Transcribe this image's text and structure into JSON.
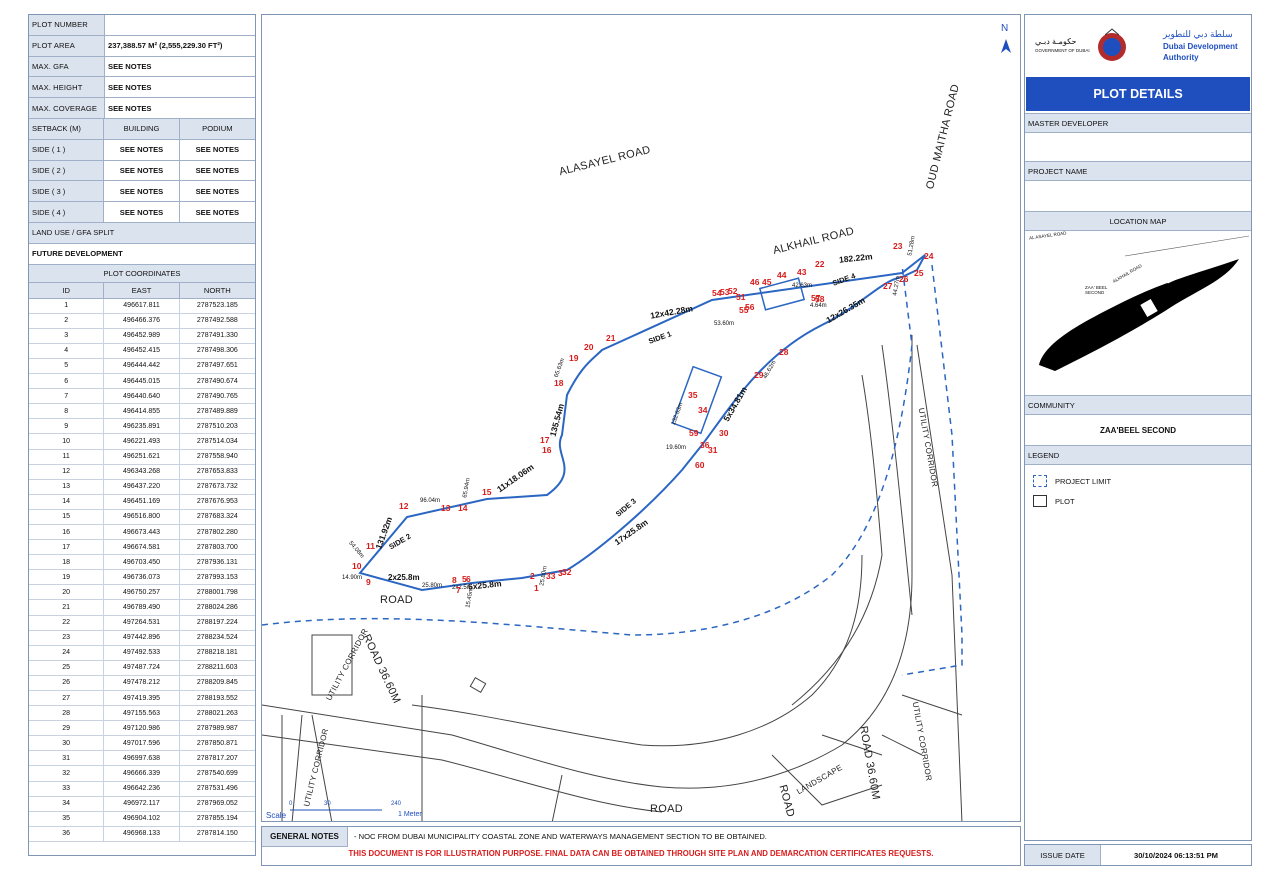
{
  "left": {
    "plot_number_label": "PLOT NUMBER",
    "plot_number_value": "",
    "plot_area_label": "PLOT AREA",
    "plot_area_value": "237,388.57 M² (2,555,229.30 FT²)",
    "max_gfa_label": "MAX. GFA",
    "max_gfa_value": "SEE NOTES",
    "max_height_label": "MAX. HEIGHT",
    "max_height_value": "SEE NOTES",
    "max_coverage_label": "MAX. COVERAGE",
    "max_coverage_value": "SEE NOTES",
    "setback_label": "SETBACK (M)",
    "building_label": "BUILDING",
    "podium_label": "PODIUM",
    "sides": [
      {
        "label": "SIDE ( 1 )",
        "building": "SEE NOTES",
        "podium": "SEE NOTES"
      },
      {
        "label": "SIDE ( 2 )",
        "building": "SEE NOTES",
        "podium": "SEE NOTES"
      },
      {
        "label": "SIDE ( 3 )",
        "building": "SEE NOTES",
        "podium": "SEE NOTES"
      },
      {
        "label": "SIDE ( 4 )",
        "building": "SEE NOTES",
        "podium": "SEE NOTES"
      }
    ],
    "land_use_label": "LAND USE / GFA SPLIT",
    "land_use_value": "FUTURE DEVELOPMENT",
    "coords_title": "PLOT COORDINATES",
    "coords_headers": [
      "ID",
      "EAST",
      "NORTH"
    ],
    "coords": [
      [
        "1",
        "496617.811",
        "2787523.185"
      ],
      [
        "2",
        "496466.376",
        "2787492.588"
      ],
      [
        "3",
        "496452.989",
        "2787491.330"
      ],
      [
        "4",
        "496452.415",
        "2787498.306"
      ],
      [
        "5",
        "496444.442",
        "2787497.651"
      ],
      [
        "6",
        "496445.015",
        "2787490.674"
      ],
      [
        "7",
        "496440.640",
        "2787490.765"
      ],
      [
        "8",
        "496414.855",
        "2787489.889"
      ],
      [
        "9",
        "496235.891",
        "2787510.203"
      ],
      [
        "10",
        "496221.493",
        "2787514.034"
      ],
      [
        "11",
        "496251.621",
        "2787558.940"
      ],
      [
        "12",
        "496343.268",
        "2787653.833"
      ],
      [
        "13",
        "496437.220",
        "2787673.732"
      ],
      [
        "14",
        "496451.169",
        "2787676.953"
      ],
      [
        "15",
        "496516.800",
        "2787683.324"
      ],
      [
        "16",
        "496673.443",
        "2787802.280"
      ],
      [
        "17",
        "496674.581",
        "2787803.700"
      ],
      [
        "18",
        "496703.450",
        "2787936.131"
      ],
      [
        "19",
        "496736.073",
        "2787993.153"
      ],
      [
        "20",
        "496750.257",
        "2788001.798"
      ],
      [
        "21",
        "496789.490",
        "2788024.286"
      ],
      [
        "22",
        "497264.531",
        "2788197.224"
      ],
      [
        "23",
        "497442.896",
        "2788234.524"
      ],
      [
        "24",
        "497492.533",
        "2788218.181"
      ],
      [
        "25",
        "497487.724",
        "2788211.603"
      ],
      [
        "26",
        "497478.212",
        "2788209.845"
      ],
      [
        "27",
        "497419.395",
        "2788193.552"
      ],
      [
        "28",
        "497155.563",
        "2788021.263"
      ],
      [
        "29",
        "497120.986",
        "2787989.987"
      ],
      [
        "30",
        "497017.596",
        "2787850.871"
      ],
      [
        "31",
        "496997.638",
        "2787817.207"
      ],
      [
        "32",
        "496666.339",
        "2787540.699"
      ],
      [
        "33",
        "496642.236",
        "2787531.496"
      ],
      [
        "34",
        "496972.117",
        "2787969.052"
      ],
      [
        "35",
        "496904.102",
        "2787855.194"
      ],
      [
        "36",
        "496968.133",
        "2787814.150"
      ]
    ]
  },
  "map": {
    "north": "N",
    "roads": {
      "alasayel": "ALASAYEL ROAD",
      "alkhail": "ALKHAIL ROAD",
      "oud_maitha": "OUD MAITHA ROAD",
      "road_left": "ROAD",
      "road_36_left": "ROAD 36.60M",
      "road_36_right": "ROAD 36.60M",
      "utility_1": "UTILITY CORRIDOR",
      "utility_2": "UTILITY CORRIDOR",
      "utility_3": "UTILITY CORRIDOR",
      "utility_4": "UTILITY CORRIDOR",
      "road_bottom": "ROAD",
      "road_bottom2": "ROAD",
      "landscape": "LANDSCAPE"
    },
    "dims": {
      "d1": "12x42.28m",
      "d2": "182.22m",
      "d3": "12x26.35m",
      "d4": "135.54m",
      "d5": "11x18.06m",
      "d6": "131.92m",
      "d7": "17x25.8m",
      "d8": "6x25.8m",
      "d9": "5x34.81m",
      "side1": "SIDE 1",
      "side2": "SIDE 2",
      "side3": "SIDE 3",
      "side4": "SIDE 4"
    },
    "small_dims": {
      "s1": "96.04m",
      "s2": "65.94m",
      "s3": "14.90m",
      "s4": "54.08m",
      "s5": "25.80m",
      "s6": "65.63m",
      "s7": "42.63m",
      "s8": "53.60m",
      "s9": "46.62m",
      "s10": "44.27m",
      "s11": "51.28m",
      "s12": "4.64m",
      "s13": "19.60m",
      "s14": "132.63m",
      "s15": "15.45m",
      "s16": "2x2.5m",
      "s17": "25.80m",
      "s18": "2x25.8m"
    },
    "point_labels": [
      "1",
      "2",
      "3",
      "5",
      "6",
      "7",
      "8",
      "9",
      "10",
      "11",
      "12",
      "13",
      "14",
      "15",
      "16",
      "17",
      "18",
      "19",
      "20",
      "21",
      "22",
      "23",
      "24",
      "25",
      "26",
      "27",
      "28",
      "29",
      "30",
      "31",
      "32",
      "33",
      "34",
      "35",
      "36",
      "43",
      "44",
      "45",
      "46",
      "51",
      "52",
      "53",
      "54",
      "55",
      "56",
      "57",
      "58",
      "59",
      "60"
    ],
    "scale_label": "Scale",
    "scale_0": "0",
    "scale_mid": "30",
    "scale_max": "240",
    "scale_unit": "1 Meter"
  },
  "notes": {
    "title": "GENERAL NOTES",
    "note1": "- NOC FROM DUBAI MUNICIPALITY COASTAL ZONE AND WATERWAYS MANAGEMENT SECTION TO BE OBTAINED.",
    "note2": "THIS DOCUMENT IS FOR ILLUSTRATION PURPOSE. FINAL DATA CAN BE OBTAINED THROUGH SITE PLAN AND DEMARCATION CERTIFICATES REQUESTS."
  },
  "right": {
    "gov_ar": "حكومـة دبـي",
    "gov_en": "GOVERNMENT OF DUBAI",
    "dda_ar": "سلطة دبي للتطوير",
    "dda_en1": "Dubai Development",
    "dda_en2": "Authority",
    "plot_details": "PLOT DETAILS",
    "master_developer_label": "MASTER DEVELOPER",
    "master_developer_value": "",
    "project_name_label": "PROJECT NAME",
    "project_name_value": "",
    "location_map_label": "LOCATION MAP",
    "loc_alasayel": "AL ASAYEL ROAD",
    "loc_alkhail": "ALKHAIL ROAD",
    "loc_zaabeel": "ZAA' BEEL SECOND",
    "community_label": "COMMUNITY",
    "community_value": "ZAA'BEEL SECOND",
    "legend_label": "LEGEND",
    "legend_project_limit": "PROJECT LIMIT",
    "legend_plot": "PLOT",
    "issue_date_label": "ISSUE DATE",
    "issue_date_value": "30/10/2024 06:13:51 PM"
  },
  "colors": {
    "accent": "#1f4fbf",
    "header_bg": "#dbe3ee",
    "point_red": "#d81b1b",
    "boundary_blue": "#2a66c2"
  }
}
